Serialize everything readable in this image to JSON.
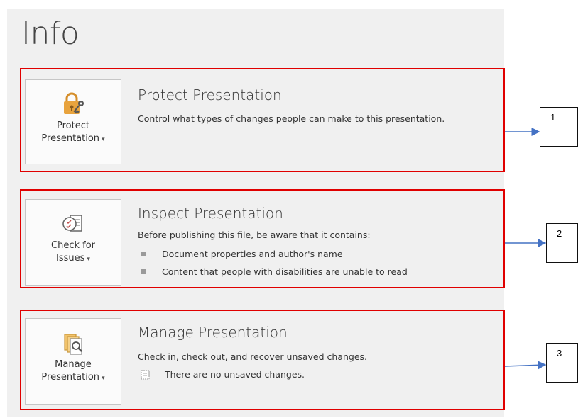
{
  "page": {
    "title": "Info"
  },
  "sections": [
    {
      "button_line1": "Protect",
      "button_line2": "Presentation",
      "title": "Protect Presentation",
      "description": "Control what types of changes people can make to this presentation.",
      "icon": "lock-key-icon"
    },
    {
      "button_line1": "Check for",
      "button_line2": "Issues",
      "title": "Inspect Presentation",
      "description": "Before publishing this file, be aware that it contains:",
      "bullets": [
        "Document properties and author's name",
        "Content that people with disabilities are unable to read"
      ],
      "icon": "check-document-icon"
    },
    {
      "button_line1": "Manage",
      "button_line2": "Presentation",
      "title": "Manage Presentation",
      "description": "Check in, check out, and recover unsaved changes.",
      "note": "There are no unsaved changes.",
      "icon": "manage-documents-icon"
    }
  ],
  "callouts": [
    "1",
    "2",
    "3"
  ],
  "colors": {
    "highlight": "#e00000",
    "arrow": "#4472c4",
    "lock": "#e8a33d"
  }
}
